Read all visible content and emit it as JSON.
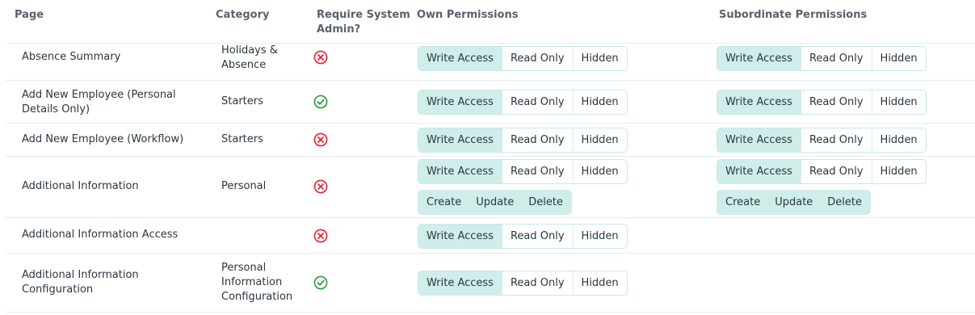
{
  "headers": {
    "page": "Page",
    "category": "Category",
    "admin_line1": "Require System",
    "admin_line2": "Admin?",
    "own": "Own Permissions",
    "sub": "Subordinate Permissions"
  },
  "access_labels": {
    "write": "Write Access",
    "read": "Read Only",
    "hidden": "Hidden"
  },
  "crud_labels": {
    "create": "Create",
    "update": "Update",
    "delete": "Delete"
  },
  "rows": [
    {
      "page_line1": "Absence Summary",
      "page_line2": "",
      "category_line1": "Holidays &",
      "category_line2": "Absence",
      "category_line3": "",
      "requires_admin": false,
      "own_selected": "Write Access",
      "sub_selected": "Write Access"
    },
    {
      "page_line1": "Add New Employee (Personal",
      "page_line2": "Details Only)",
      "category_line1": "Starters",
      "category_line2": "",
      "category_line3": "",
      "requires_admin": true,
      "own_selected": "Write Access",
      "sub_selected": "Write Access"
    },
    {
      "page_line1": "Add New Employee (Workflow)",
      "page_line2": "",
      "category_line1": "Starters",
      "category_line2": "",
      "category_line3": "",
      "requires_admin": false,
      "own_selected": "Write Access",
      "sub_selected": "Write Access"
    },
    {
      "page_line1": "Additional Information",
      "page_line2": "",
      "category_line1": "Personal",
      "category_line2": "",
      "category_line3": "",
      "requires_admin": false,
      "own_selected": "Write Access",
      "sub_selected": "Write Access"
    },
    {
      "page_line1": "Additional Information Access",
      "page_line2": "",
      "category_line1": "",
      "category_line2": "",
      "category_line3": "",
      "requires_admin": false,
      "own_selected": "Write Access",
      "sub_selected": ""
    },
    {
      "page_line1": "Additional Information",
      "page_line2": "Configuration",
      "category_line1": "Personal",
      "category_line2": "Information",
      "category_line3": "Configuration",
      "requires_admin": true,
      "own_selected": "Write Access",
      "sub_selected": ""
    }
  ],
  "colors": {
    "selected_bg": "#cfeeea",
    "cross": "#e0252f",
    "check": "#2e9a3c"
  }
}
